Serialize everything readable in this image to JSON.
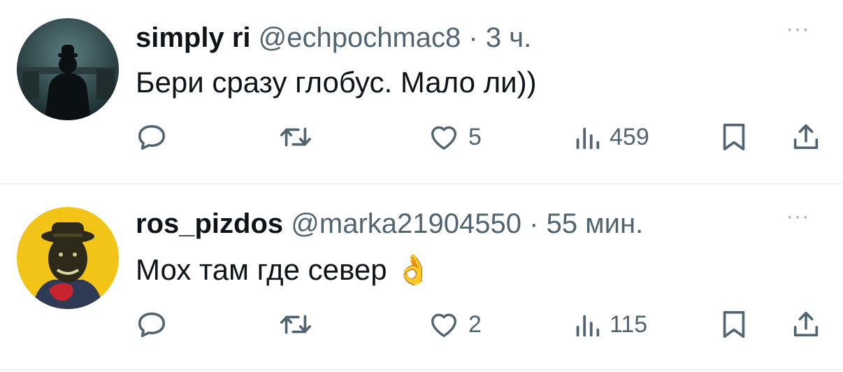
{
  "tweets": [
    {
      "name": "simply ri",
      "handle": "@echpochmac8",
      "sep": "·",
      "time": "3 ч.",
      "more": "···",
      "text": "Бери сразу глобус. Мало ли))",
      "emoji": "",
      "likes": "5",
      "views": "459",
      "avatar_colors": [
        "#3e5a5c",
        "#0c1417"
      ]
    },
    {
      "name": "ros_pizdos",
      "handle": "@marka21904550",
      "sep": "·",
      "time": "55 мин.",
      "more": "···",
      "text": "Мох там где север",
      "emoji": "👌",
      "likes": "2",
      "views": "115",
      "avatar_colors": [
        "#f2c418",
        "#2a2716"
      ]
    }
  ],
  "icons": {
    "reply": "reply-icon",
    "retweet": "retweet-icon",
    "like": "heart-icon",
    "views": "views-icon",
    "bookmark": "bookmark-icon",
    "share": "share-icon"
  },
  "colors": {
    "text": "#0f1419",
    "secondary": "#536471",
    "divider": "#eff3f4",
    "more": "#aab8c2"
  }
}
